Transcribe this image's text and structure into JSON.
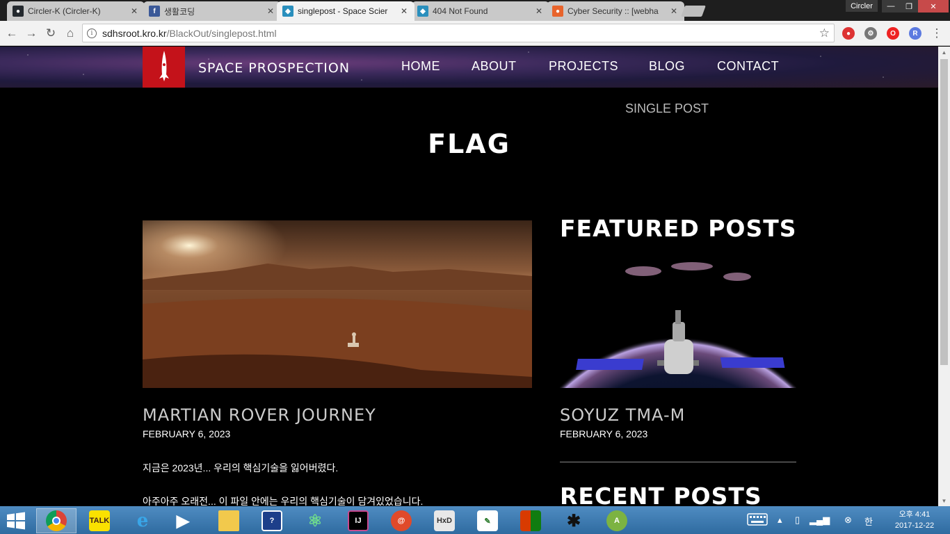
{
  "browser": {
    "tabs": [
      {
        "title": "Circler-K (Circler-K)",
        "icon": "github-icon",
        "color": "#24292e"
      },
      {
        "title": "생활코딩",
        "icon": "facebook-icon",
        "color": "#3b5998"
      },
      {
        "title": "singlepost - Space Scier",
        "icon": "site-icon",
        "color": "#2a8fbd"
      },
      {
        "title": "404 Not Found",
        "icon": "site-icon",
        "color": "#2a8fbd"
      },
      {
        "title": "Cyber Security :: [webha",
        "icon": "tistory-icon",
        "color": "#e8642c"
      }
    ],
    "tab_close": "✕",
    "profile_label": "Circler",
    "url_host": "sdhsroot.kro.kr",
    "url_path": "/BlackOut/singlepost.html"
  },
  "site": {
    "brand": "SPACE PROSPECTION",
    "nav": [
      "HOME",
      "ABOUT",
      "PROJECTS",
      "BLOG",
      "CONTACT"
    ],
    "breadcrumb": "SINGLE POST",
    "page_title": "FLAG"
  },
  "post": {
    "title": "MARTIAN ROVER JOURNEY",
    "date": "FEBRUARY 6, 2023",
    "paragraphs": [
      "지금은 2023년... 우리의 핵심기술을 잃어버렸다.",
      "아주아주 오래전... 이 파일 안에는 우리의 핵심기술이 담겨있었습니다."
    ]
  },
  "sidebar": {
    "featured_heading": "FEATURED POSTS",
    "featured_title": "SOYUZ TMA-M",
    "featured_date": "FEBRUARY 6, 2023",
    "recent_heading": "RECENT POSTS"
  },
  "taskbar": {
    "apps": [
      "chrome",
      "kakaotalk",
      "internet-explorer",
      "media-player",
      "file-explorer",
      "help",
      "atom",
      "intellij",
      "snail-app",
      "hxd",
      "notepad",
      "office",
      "bug-app",
      "android-studio"
    ],
    "ime_label": "한",
    "time": "오후 4:41",
    "date": "2017-12-22"
  }
}
